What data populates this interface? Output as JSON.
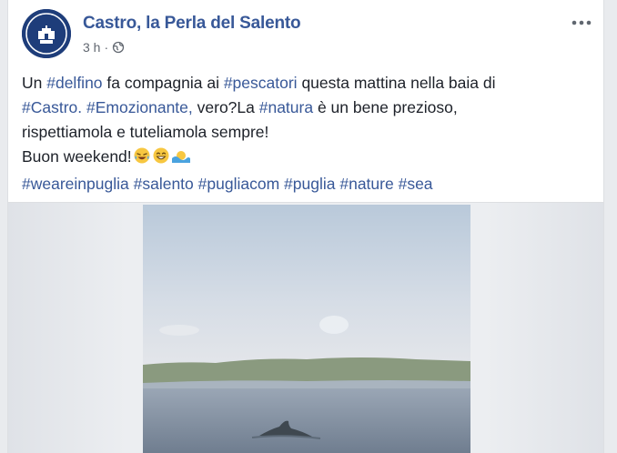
{
  "post": {
    "page_name": "Castro, la Perla del Salento",
    "time": "3 h",
    "separator": "·",
    "privacy_icon": "globe-icon",
    "more_icon": "more-options-icon",
    "text": {
      "line1": {
        "p1": "Un ",
        "tag1": "#delfino",
        "p2": " fa compagnia ai ",
        "tag2": "#pescatori",
        "p3": " questa mattina nella baia di"
      },
      "line2": {
        "tag1": "#Castro.",
        "p1": " ",
        "tag2": "#Emozionante,",
        "p2": " vero?La ",
        "tag3": "#natura",
        "p3": " è un bene prezioso,"
      },
      "line3": "rispettiamola e tuteliamola sempre!",
      "line4": "Buon weekend!",
      "emojis": [
        "laughing-tears-emoji",
        "grinning-emoji",
        "sun-behind-wave-emoji"
      ],
      "hashtags": [
        "#weareinpuglia",
        "#salento",
        "#pugliacom",
        "#puglia",
        "#nature",
        "#sea"
      ]
    }
  },
  "colors": {
    "link": "#385898",
    "text": "#1d2129",
    "meta": "#616770",
    "background": "#e9ebee"
  }
}
